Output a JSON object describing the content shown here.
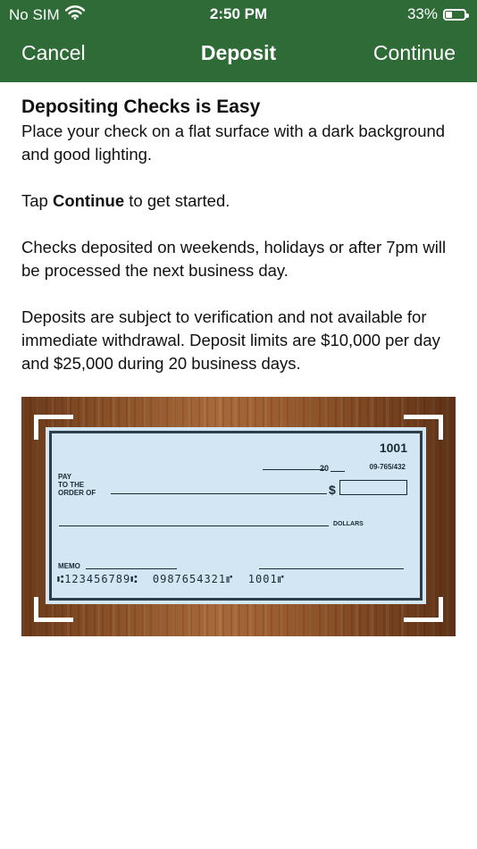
{
  "status": {
    "carrier": "No SIM",
    "time": "2:50 PM",
    "battery_percent": "33%",
    "battery_level": 0.33,
    "wifi_icon": "wifi-icon"
  },
  "nav": {
    "cancel_label": "Cancel",
    "title": "Deposit",
    "continue_label": "Continue"
  },
  "content": {
    "heading": "Depositing Checks is Easy",
    "intro": "Place your check on a flat surface with a dark background and good lighting.",
    "tap_prefix": "Tap ",
    "tap_bold": "Continue",
    "tap_suffix": " to get started.",
    "weekends": "Checks deposited on weekends, holidays or after 7pm will be processed the next business day.",
    "limits": "Deposits are subject to verification and not available for immediate withdrawal. Deposit limits are $10,000 per day and $25,000 during 20 business days."
  },
  "check": {
    "number": "1001",
    "routing_fraction": "09-765/432",
    "year_prefix": "20",
    "pay_line1": "PAY",
    "pay_line2": "TO THE",
    "pay_line3": "ORDER OF",
    "dollar_sign": "$",
    "dollars_label": "DOLLARS",
    "memo_label": "MEMO",
    "micr": "⑆123456789⑆  0987654321⑈  1001⑈"
  },
  "colors": {
    "header_bg": "#2e6b37",
    "check_bg": "#d3e6f3"
  }
}
